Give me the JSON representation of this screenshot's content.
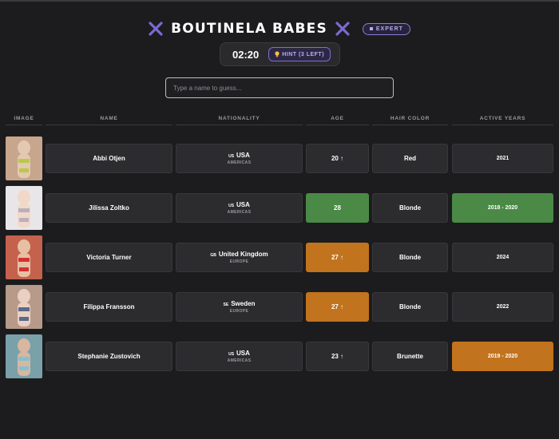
{
  "app": {
    "title": "BOUTINELA BABES",
    "mode_badge": "EXPERT",
    "timer": "02:20",
    "hint_label": "HINT (3 LEFT)"
  },
  "search": {
    "placeholder": "Type a name to guess..."
  },
  "columns": [
    "IMAGE",
    "NAME",
    "NATIONALITY",
    "AGE",
    "HAIR COLOR",
    "ACTIVE YEARS"
  ],
  "colors": {
    "correct": "#4a8a46",
    "close": "#c2731e",
    "cell": "#2c2c2f",
    "accent": "#7d6fd0"
  },
  "rows": [
    {
      "name": "Abbi Otjen",
      "country_code": "US",
      "country": "USA",
      "region": "AMERICAS",
      "age": "20 ↑",
      "hair": "Red",
      "years": "2021",
      "status": {
        "age": "none",
        "years": "none"
      }
    },
    {
      "name": "Jilissa Zoltko",
      "country_code": "US",
      "country": "USA",
      "region": "AMERICAS",
      "age": "28",
      "hair": "Blonde",
      "years": "2018 - 2020",
      "status": {
        "age": "correct",
        "years": "correct"
      }
    },
    {
      "name": "Victoria Turner",
      "country_code": "GB",
      "country": "United Kingdom",
      "region": "EUROPE",
      "age": "27 ↑",
      "hair": "Blonde",
      "years": "2024",
      "status": {
        "age": "close",
        "years": "none"
      }
    },
    {
      "name": "Filippa Fransson",
      "country_code": "SE",
      "country": "Sweden",
      "region": "EUROPE",
      "age": "27 ↑",
      "hair": "Blonde",
      "years": "2022",
      "status": {
        "age": "close",
        "years": "none"
      }
    },
    {
      "name": "Stephanie Zustovich",
      "country_code": "US",
      "country": "USA",
      "region": "AMERICAS",
      "age": "23 ↑",
      "hair": "Brunette",
      "years": "2019 - 2020",
      "status": {
        "age": "none",
        "years": "close"
      }
    }
  ]
}
